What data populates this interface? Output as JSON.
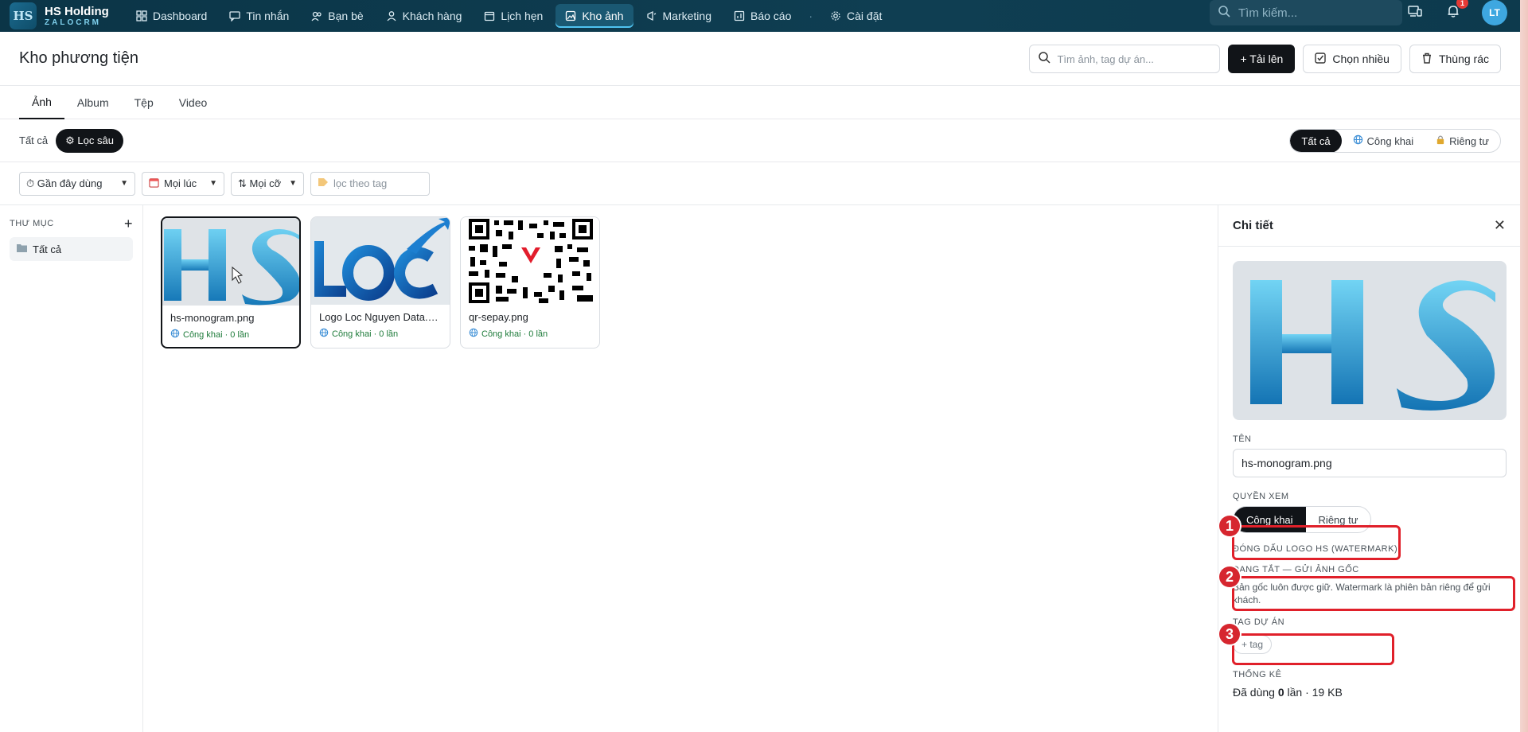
{
  "topbar": {
    "brand_name": "HS Holding",
    "brand_sub": "ZALOCRM",
    "brand_logo_text": "HS",
    "nav": [
      {
        "label": "Dashboard",
        "icon": "grid-icon"
      },
      {
        "label": "Tin nhắn",
        "icon": "message-icon"
      },
      {
        "label": "Bạn bè",
        "icon": "friends-icon"
      },
      {
        "label": "Khách hàng",
        "icon": "user-icon"
      },
      {
        "label": "Lịch hẹn",
        "icon": "calendar-icon"
      },
      {
        "label": "Kho ảnh",
        "icon": "image-icon",
        "active": true
      },
      {
        "label": "Marketing",
        "icon": "megaphone-icon"
      },
      {
        "label": "Báo cáo",
        "icon": "chart-icon"
      },
      {
        "label": "Cài đặt",
        "icon": "gear-icon"
      }
    ],
    "search_placeholder": "Tìm kiếm...",
    "notif_count": "1",
    "avatar_initials": "LT"
  },
  "header": {
    "title": "Kho phương tiện",
    "search_placeholder": "Tìm ảnh, tag dự án...",
    "upload_label": "+ Tải lên",
    "multi_label": "Chọn nhiều",
    "trash_label": "Thùng rác"
  },
  "tabs": [
    "Ảnh",
    "Album",
    "Tệp",
    "Video"
  ],
  "filter1": {
    "all_label": "Tất cả",
    "deep_label": "⚙ Lọc sâu",
    "visibility": [
      "Tất cả",
      "Công khai",
      "Riêng tư"
    ]
  },
  "filter2": {
    "sort": "⏱ Gần đây dùng",
    "time": "Mọi lúc",
    "size": "⇅ Mọi cỡ",
    "tag_placeholder": "lọc theo tag"
  },
  "folders": {
    "heading": "THƯ MỤC",
    "add": "+",
    "items": [
      "Tất cả"
    ]
  },
  "cards": [
    {
      "name": "hs-monogram.png",
      "meta": "Công khai · 0 lần"
    },
    {
      "name": "Logo Loc Nguyen Data.png",
      "meta": "Công khai · 0 lần"
    },
    {
      "name": "qr-sepay.png",
      "meta": "Công khai · 0 lần"
    }
  ],
  "detail": {
    "title": "Chi tiết",
    "name_label": "TÊN",
    "name_value": "hs-monogram.png",
    "perm_label": "QUYỀN XEM",
    "perm_options": [
      "Công khai",
      "Riêng tư"
    ],
    "watermark_label": "ĐÓNG DẤU LOGO HS (WATERMARK)",
    "watermark_state": "ĐANG TẮT — GỬI ẢNH GỐC",
    "watermark_desc": "Bản gốc luôn được giữ. Watermark là phiên bản riêng để gửi khách.",
    "tag_label": "TAG DỰ ÁN",
    "tag_chip": "+ tag",
    "stats_label": "THỐNG KÊ",
    "stats_prefix": "Đã dùng",
    "stats_count": "0",
    "stats_suffix": "lần · 19 KB"
  },
  "annotations": [
    "1",
    "2",
    "3"
  ],
  "colors": {
    "topbar": "#0f3e52",
    "accent": "#4fc3f0",
    "primary_button": "#111418",
    "public_green": "#1e7b3a",
    "annotation_red": "#e0202a"
  }
}
